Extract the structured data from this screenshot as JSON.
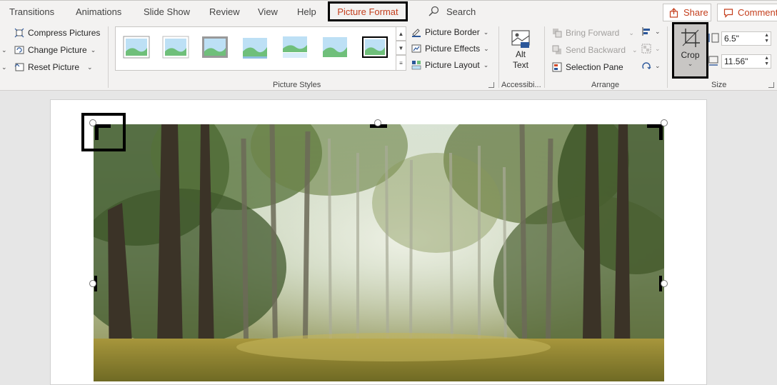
{
  "tabs": {
    "transitions": "Transitions",
    "animations": "Animations",
    "slide_show": "Slide Show",
    "review": "Review",
    "view": "View",
    "help": "Help",
    "picture_format": "Picture Format",
    "search": "Search"
  },
  "header": {
    "share": "Share",
    "comments": "Comments"
  },
  "adjust": {
    "compress": "Compress Pictures",
    "change": "Change Picture",
    "reset": "Reset Picture"
  },
  "styles": {
    "border": "Picture Border",
    "effects": "Picture Effects",
    "layout": "Picture Layout",
    "group_label": "Picture Styles"
  },
  "accessibility": {
    "alt_line1": "Alt",
    "alt_line2": "Text",
    "group_label": "Accessibi..."
  },
  "arrange": {
    "bring_forward": "Bring Forward",
    "send_backward": "Send Backward",
    "selection_pane": "Selection Pane",
    "group_label": "Arrange"
  },
  "size": {
    "crop": "Crop",
    "height": "6.5\"",
    "width": "11.56\"",
    "group_label": "Size"
  },
  "colors": {
    "accent": "#c43e1c",
    "highlight": "#000000"
  }
}
